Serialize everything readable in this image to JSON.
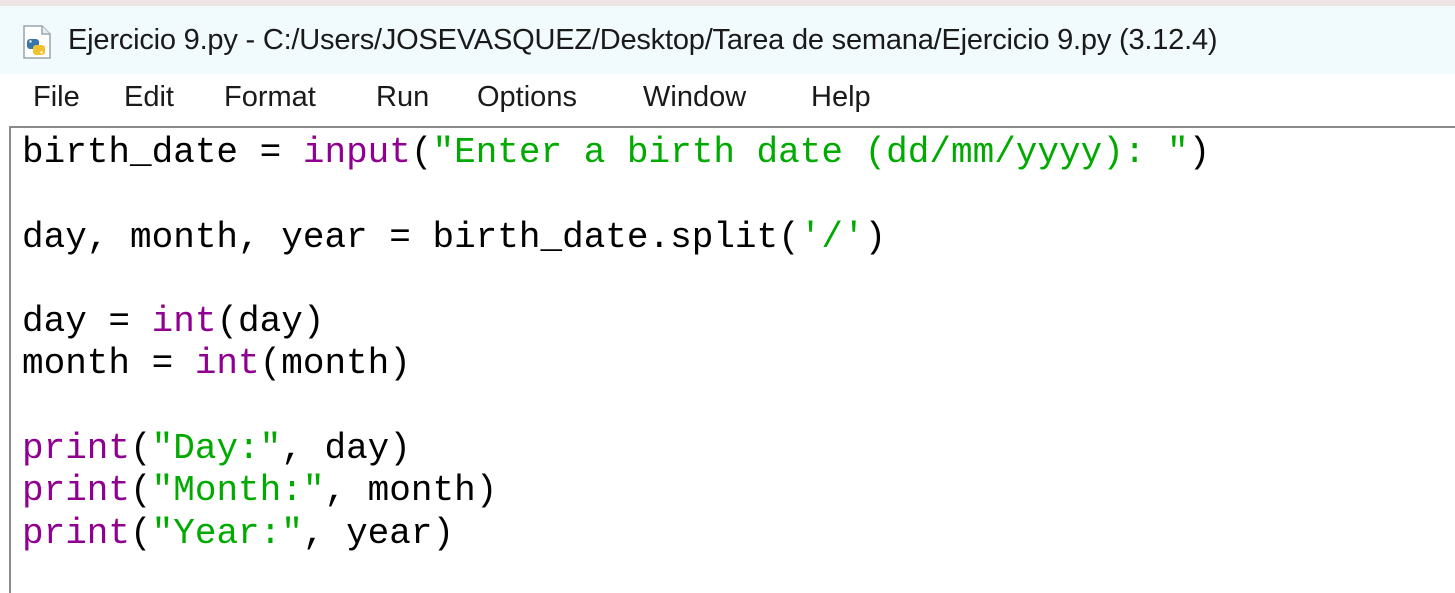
{
  "window": {
    "title": "Ejercicio 9.py - C:/Users/JOSEVASQUEZ/Desktop/Tarea de semana/Ejercicio 9.py (3.12.4)",
    "icon": "python-file-icon"
  },
  "menu": {
    "items": [
      "File",
      "Edit",
      "Format",
      "Run",
      "Options",
      "Window",
      "Help"
    ]
  },
  "colors": {
    "builtin": "#900090",
    "string": "#00aa00",
    "text": "#000000"
  },
  "code": {
    "line1": {
      "a": "birth_date = ",
      "b": "input",
      "c": "(",
      "d": "\"Enter a birth date (dd/mm/yyyy): \"",
      "e": ")"
    },
    "line3": {
      "a": "day, month, year = birth_date.split(",
      "b": "'/'",
      "c": ")"
    },
    "line5": {
      "a": "day = ",
      "b": "int",
      "c": "(day)"
    },
    "line6": {
      "a": "month = ",
      "b": "int",
      "c": "(month)"
    },
    "line8": {
      "a": "print",
      "b": "(",
      "c": "\"Day:\"",
      "d": ", day)"
    },
    "line9": {
      "a": "print",
      "b": "(",
      "c": "\"Month:\"",
      "d": ", month)"
    },
    "line10": {
      "a": "print",
      "b": "(",
      "c": "\"Year:\"",
      "d": ", year)"
    }
  }
}
